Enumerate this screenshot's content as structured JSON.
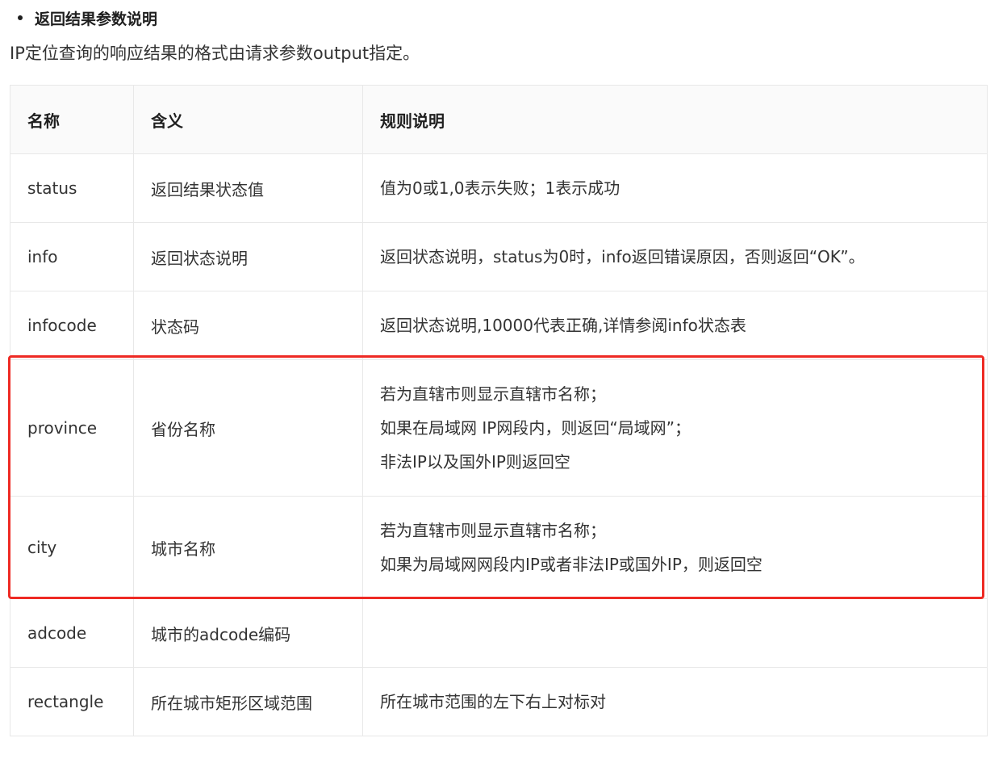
{
  "heading": "返回结果参数说明",
  "intro": "IP定位查询的响应结果的格式由请求参数output指定。",
  "table": {
    "headers": [
      "名称",
      "含义",
      "规则说明"
    ],
    "rows": [
      {
        "name": "status",
        "meaning": "返回结果状态值",
        "rules": [
          "值为0或1,0表示失败；1表示成功"
        ]
      },
      {
        "name": "info",
        "meaning": "返回状态说明",
        "rules": [
          "返回状态说明，status为0时，info返回错误原因，否则返回“OK”。"
        ]
      },
      {
        "name": "infocode",
        "meaning": "状态码",
        "rules": [
          "返回状态说明,10000代表正确,详情参阅info状态表"
        ]
      },
      {
        "name": "province",
        "meaning": "省份名称",
        "rules": [
          "若为直辖市则显示直辖市名称；",
          "如果在局域网 IP网段内，则返回“局域网”；",
          "非法IP以及国外IP则返回空"
        ]
      },
      {
        "name": "city",
        "meaning": "城市名称",
        "rules": [
          "若为直辖市则显示直辖市名称；",
          "如果为局域网网段内IP或者非法IP或国外IP，则返回空"
        ]
      },
      {
        "name": "adcode",
        "meaning": "城市的adcode编码",
        "rules": [
          ""
        ]
      },
      {
        "name": "rectangle",
        "meaning": "所在城市矩形区域范围",
        "rules": [
          "所在城市范围的左下右上对标对"
        ]
      }
    ]
  },
  "highlight_color": "#ee2a24"
}
